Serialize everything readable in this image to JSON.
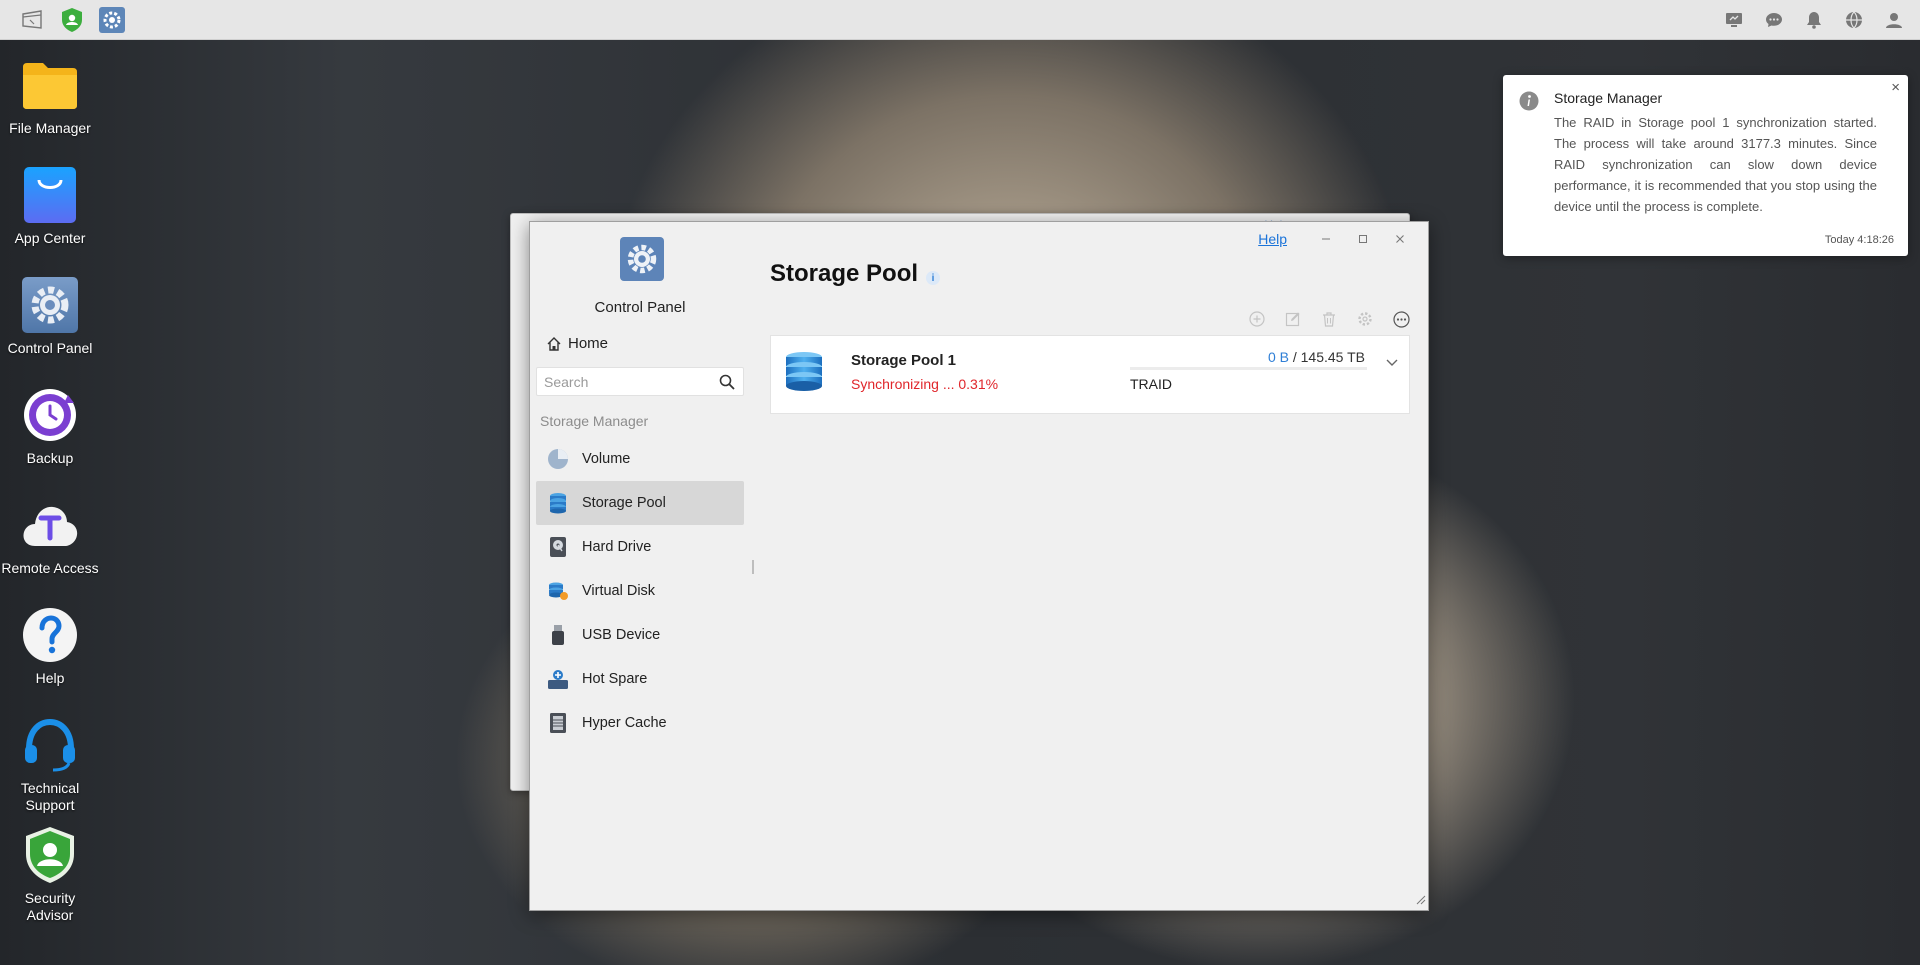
{
  "taskbar": {
    "left_icons": [
      "show-desktop-icon",
      "security-advisor-taskbar-icon",
      "control-panel-taskbar-icon"
    ],
    "right_icons": [
      "remote-desktop-icon",
      "chat-icon",
      "notification-bell-icon",
      "language-globe-icon",
      "user-account-icon"
    ]
  },
  "desktop": {
    "icons": [
      {
        "label": "File Manager",
        "icon": "folder-icon"
      },
      {
        "label": "App Center",
        "icon": "shopping-bag-icon"
      },
      {
        "label": "Control Panel",
        "icon": "gear-icon"
      },
      {
        "label": "Backup",
        "icon": "backup-clock-icon"
      },
      {
        "label": "Remote Access",
        "icon": "cloud-t-icon"
      },
      {
        "label": "Help",
        "icon": "question-icon"
      },
      {
        "label": "Technical Support",
        "icon": "headset-icon"
      },
      {
        "label": "Security Advisor",
        "icon": "shield-icon"
      }
    ]
  },
  "window": {
    "help_label": "Help",
    "app_title": "Control Panel",
    "home_label": "Home",
    "search": {
      "placeholder": "Search",
      "value": ""
    },
    "section_label": "Storage Manager",
    "nav_items": [
      {
        "label": "Volume",
        "icon": "volume-pie-icon",
        "active": false
      },
      {
        "label": "Storage Pool",
        "icon": "storage-pool-icon",
        "active": true
      },
      {
        "label": "Hard Drive",
        "icon": "hard-drive-icon",
        "active": false
      },
      {
        "label": "Virtual Disk",
        "icon": "virtual-disk-icon",
        "active": false
      },
      {
        "label": "USB Device",
        "icon": "usb-icon",
        "active": false
      },
      {
        "label": "Hot Spare",
        "icon": "hot-spare-icon",
        "active": false
      },
      {
        "label": "Hyper Cache",
        "icon": "hyper-cache-icon",
        "active": false
      }
    ],
    "page_title": "Storage Pool",
    "info_glyph": "i",
    "toolbar_icons": [
      "add-icon",
      "edit-icon",
      "delete-icon",
      "settings-icon",
      "more-icon"
    ],
    "pool": {
      "name": "Storage Pool 1",
      "status": "Synchronizing ... 0.31%",
      "used": "0 B",
      "separator": "/",
      "total": "145.45 TB",
      "usage_fraction": 0,
      "raid": "TRAID"
    }
  },
  "notification": {
    "title": "Storage Manager",
    "body": "The RAID in Storage pool 1 synchronization started. The process will take around 3177.3 minutes. Since RAID synchronization can slow down device performance, it is recommended that you stop using the device until the process is complete.",
    "time": "Today 4:18:26",
    "close_glyph": "×"
  },
  "colors": {
    "accent": "#2f7fd6",
    "status_red": "#e0262b",
    "taskbar_bg": "#e6e6e6"
  }
}
